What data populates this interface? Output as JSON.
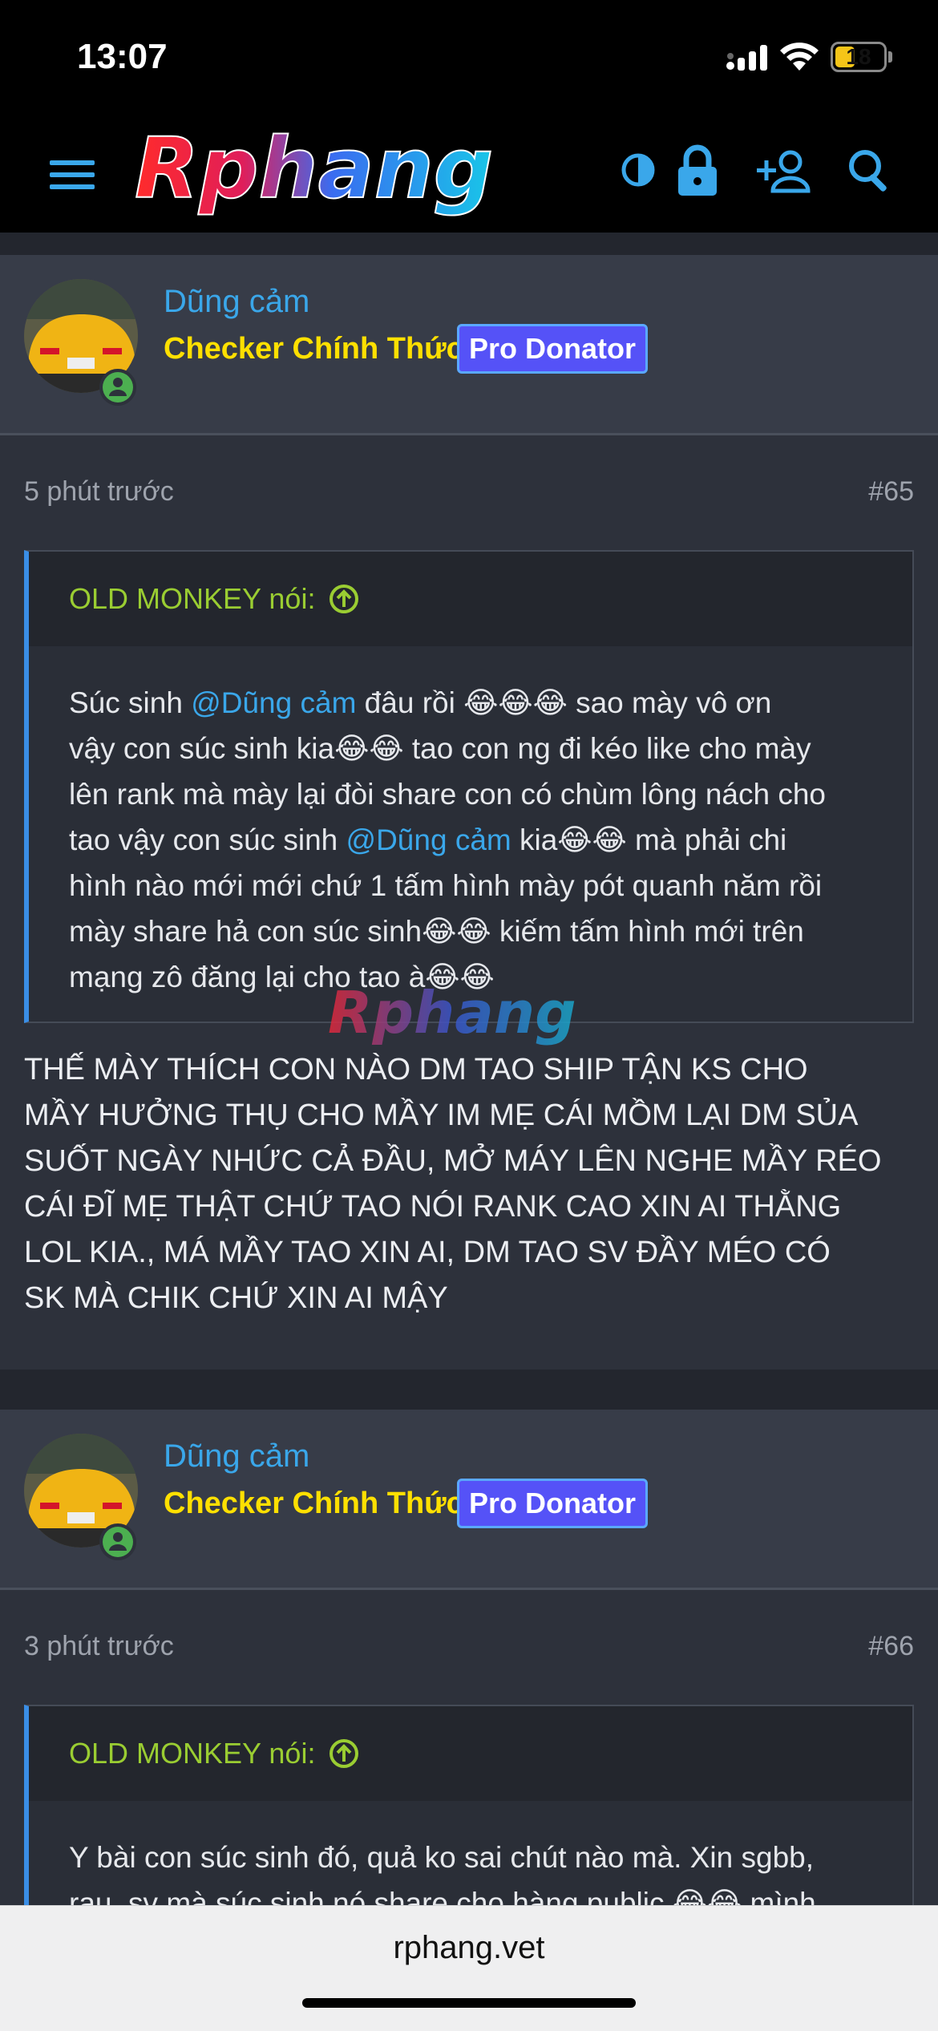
{
  "status_bar": {
    "time": "13:07",
    "battery": "18"
  },
  "header": {
    "logo_text": "Rphang",
    "menu_icon": "menu-icon",
    "theme_icon": "theme-toggle-icon",
    "lock_icon": "lock-icon",
    "register_icon": "add-user-icon",
    "search_icon": "search-icon"
  },
  "posts": [
    {
      "username": "Dũng cảm",
      "user_title": "Checker Chính Thức",
      "badge": "Pro Donator",
      "time_ago": "5 phút trước",
      "number": "#65",
      "quote": {
        "author": "OLD MONKEY nói:",
        "body_parts": {
          "p1": "Súc sinh ",
          "m1": "@Dũng cảm",
          "p2": " đâu rồi 😂😂😂 sao mày vô ơn\nvậy con súc sinh kia😂😂 tao con ng đi kéo like cho mày\nlên rank mà mày lại đòi share con có chùm lông nách cho\ntao vậy con súc sinh ",
          "m2": "@Dũng cảm",
          "p3": " kia😂😂 mà phải chi\nhình nào mới mới chứ 1 tấm hình mày pót quanh năm rồi\nmày share hả con súc sinh😂😂 kiếm tấm hình mới trên\nmạng zô đăng lại cho tao à😂😂"
        }
      },
      "body": "THẾ MÀY THÍCH CON NÀO DM TAO SHIP TẬN KS CHO\nMẦY HƯỞNG THỤ CHO MẦY IM MẸ CÁI MỒM LẠI DM SỦA\nSUỐT NGÀY NHỨC CẢ ĐẦU, MỞ MÁY LÊN NGHE MẦY RÉO\nCÁI ĐĨ MẸ THẬT CHỨ TAO NÓI RANK CAO XIN AI THẰNG\nLOL KIA., MÁ MẦY TAO XIN AI, DM TAO SV ĐẦY MÉO CÓ\nSK MÀ CHIK CHỨ XIN AI MẬY"
    },
    {
      "username": "Dũng cảm",
      "user_title": "Checker Chính Thức",
      "badge": "Pro Donator",
      "time_ago": "3 phút trước",
      "number": "#66",
      "quote": {
        "author": "OLD MONKEY nói:",
        "body": "Y bài con súc sinh đó, quả ko sai chút nào mà. Xin sgbb,\nrau, sv mà súc sinh nó share cho hàng public.😂😂 mình"
      }
    }
  ],
  "watermark_text": "Rphang",
  "browser": {
    "url": "rphang.vet"
  },
  "colors": {
    "accent": "#3aa7ea",
    "title_yellow": "#ffe000",
    "badge_bg": "#5552f7",
    "quote_author": "#9acd32",
    "online": "#4caf50"
  }
}
